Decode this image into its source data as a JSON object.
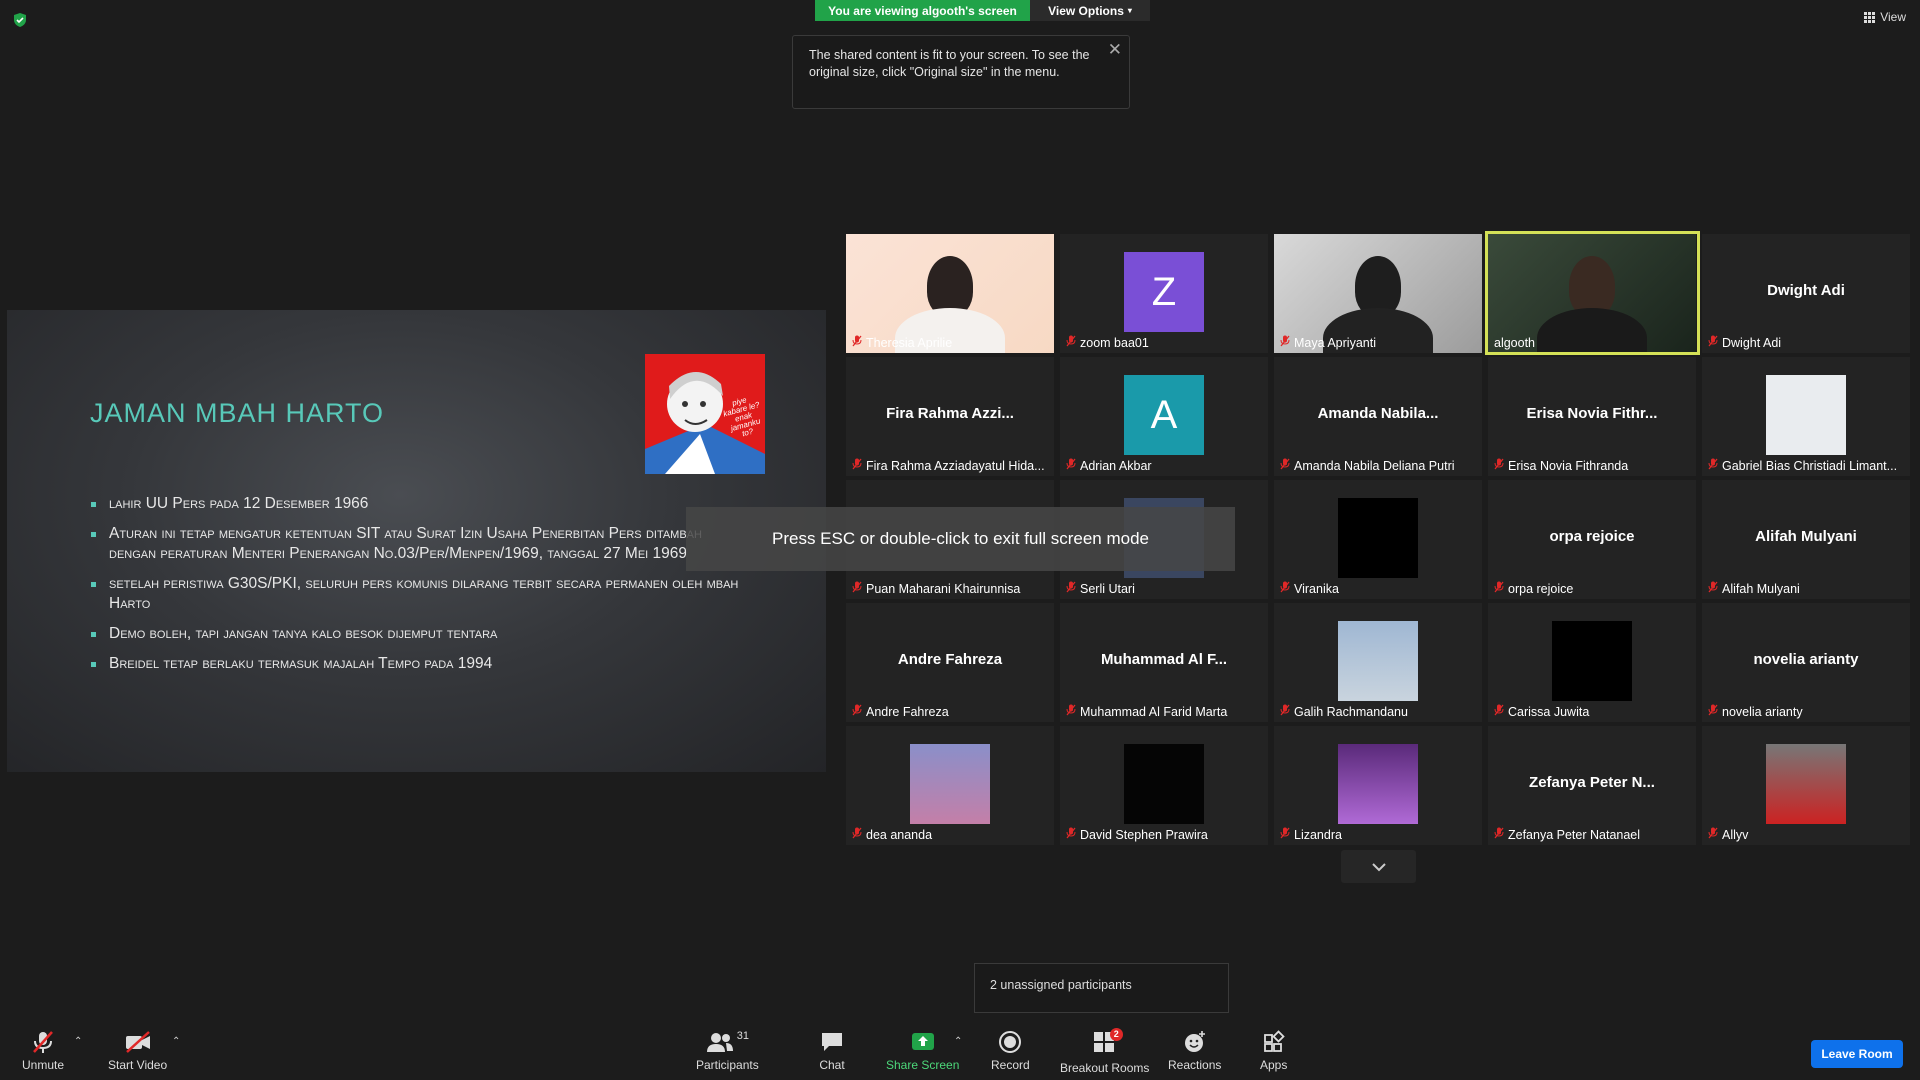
{
  "header": {
    "viewing_label": "You are viewing algooth's screen",
    "view_options_label": "View Options",
    "tip_text": "The shared content is fit to your screen. To see the original size, click \"Original size\" in the menu.",
    "view_label": "View"
  },
  "slide": {
    "title": "JAMAN MBAH HARTO",
    "bullets": [
      "lahir UU Pers pada 12 Desember 1966",
      "Aturan ini tetap mengatur ketentuan SIT atau Surat Izin Usaha Penerbitan Pers ditambah dengan peraturan Menteri Penerangan No.03/Per/Menpen/1969, tanggal 27 Mei 1969",
      "setelah peristiwa G30S/PKI, seluruh pers komunis dilarang terbit secara permanen oleh mbah Harto",
      "Demo boleh, tapi jangan tanya kalo besok dijemput tentara",
      "Breidel tetap berlaku termasuk majalah Tempo pada 1994"
    ],
    "image_text": "piye kabare le? enak jamanku to?"
  },
  "participants": [
    {
      "name": "Theresia Aprilie",
      "display": ""
    },
    {
      "name": "zoom baa01",
      "display": "Z"
    },
    {
      "name": "Maya Apriyanti",
      "display": ""
    },
    {
      "name": "algooth",
      "display": ""
    },
    {
      "name": "Dwight Adi",
      "display": "Dwight Adi"
    },
    {
      "name": "Fira Rahma Azziadayatul Hida...",
      "display": "Fira Rahma Azzi..."
    },
    {
      "name": "Adrian Akbar",
      "display": "A"
    },
    {
      "name": "Amanda Nabila Deliana Putri",
      "display": "Amanda Nabila..."
    },
    {
      "name": "Erisa Novia Fithranda",
      "display": "Erisa Novia Fithr..."
    },
    {
      "name": "Gabriel Bias Christiadi Limant...",
      "display": ""
    },
    {
      "name": "Puan Maharani Khairunnisa",
      "display": ""
    },
    {
      "name": "Serli Utari",
      "display": ""
    },
    {
      "name": "Viranika",
      "display": ""
    },
    {
      "name": "orpa rejoice",
      "display": "orpa rejoice"
    },
    {
      "name": "Alifah Mulyani",
      "display": "Alifah Mulyani"
    },
    {
      "name": "Andre Fahreza",
      "display": "Andre Fahreza"
    },
    {
      "name": "Muhammad Al Farid Marta",
      "display": "Muhammad Al F..."
    },
    {
      "name": "Galih Rachmandanu",
      "display": ""
    },
    {
      "name": "Carissa Juwita",
      "display": ""
    },
    {
      "name": "novelia arianty",
      "display": "novelia arianty"
    },
    {
      "name": "dea ananda",
      "display": ""
    },
    {
      "name": "David Stephen Prawira",
      "display": ""
    },
    {
      "name": "Lizandra",
      "display": ""
    },
    {
      "name": "Zefanya Peter Natanael",
      "display": "Zefanya Peter N..."
    },
    {
      "name": "Allyv",
      "display": ""
    }
  ],
  "overlay": {
    "esc_message": "Press ESC or double-click to exit full screen mode",
    "unassigned": "2 unassigned participants"
  },
  "toolbar": {
    "unmute": "Unmute",
    "start_video": "Start Video",
    "participants": "Participants",
    "participants_count": "31",
    "chat": "Chat",
    "share_screen": "Share Screen",
    "record": "Record",
    "breakout_rooms": "Breakout Rooms",
    "breakout_badge": "2",
    "reactions": "Reactions",
    "apps": "Apps",
    "leave": "Leave Room"
  },
  "colors": {
    "accent_green": "#21a349",
    "active_speaker": "#d4e157",
    "slide_title": "#58c9b9",
    "leave_button": "#0e71eb",
    "mute_red": "#e02828"
  }
}
